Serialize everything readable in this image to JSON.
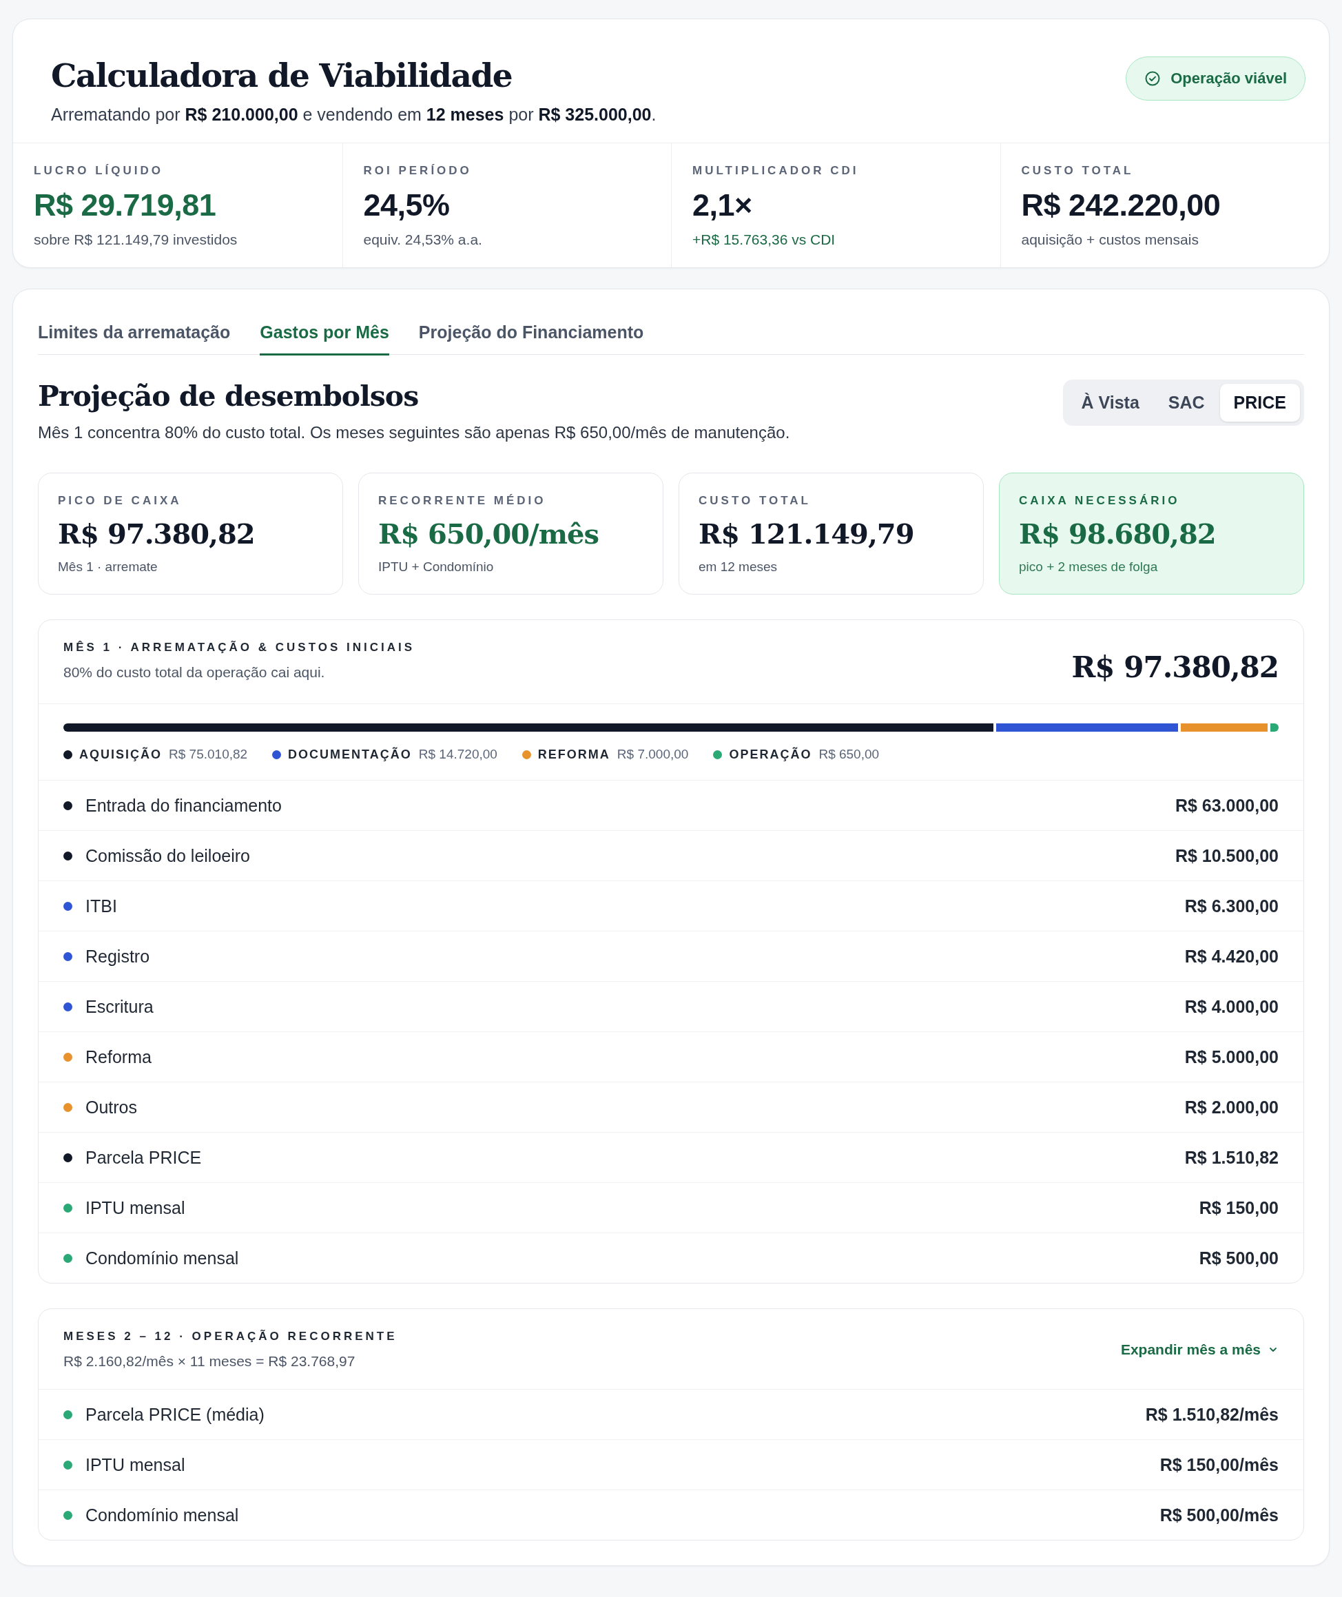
{
  "header": {
    "title": "Calculadora de Viabilidade",
    "subtitle": "Arrematando por **R$ 210.000,00** e vendendo em **12 meses** por **R$ 325.000,00**.",
    "status": {
      "label": "Operação viável",
      "ok": true
    }
  },
  "kpis": [
    {
      "label": "LUCRO LÍQUIDO",
      "value": "R$ 29.719,81",
      "note": "sobre R$ 121.149,79 investidos",
      "value_positive": true,
      "note_positive": false
    },
    {
      "label": "ROI PERÍODO",
      "value": "24,5%",
      "note": "equiv. 24,53% a.a.",
      "value_positive": false,
      "note_positive": false
    },
    {
      "label": "MULTIPLICADOR CDI",
      "value": "2,1×",
      "note": "+R$ 15.763,36 vs CDI",
      "value_positive": false,
      "note_positive": true
    },
    {
      "label": "CUSTO TOTAL",
      "value": "R$ 242.220,00",
      "note": "aquisição + custos mensais",
      "value_positive": false,
      "note_positive": false
    }
  ],
  "tabs": [
    {
      "label": "Limites da arrematação",
      "selected": false
    },
    {
      "label": "Gastos por Mês",
      "selected": true
    },
    {
      "label": "Projeção do Financiamento",
      "selected": false
    }
  ],
  "section": {
    "title": "Projeção de desembolsos",
    "description": "Mês 1 concentra 80% do custo total. Os meses seguintes são apenas R$ 650,00/mês de manutenção."
  },
  "modes": [
    {
      "label": "À Vista",
      "selected": false
    },
    {
      "label": "SAC",
      "selected": false
    },
    {
      "label": "PRICE",
      "selected": true
    }
  ],
  "summary_cards": [
    {
      "label": "PICO DE CAIXA",
      "value": "R$ 97.380,82",
      "note": "Mês 1 · arremate",
      "value_positive": false,
      "highlighted": false
    },
    {
      "label": "RECORRENTE MÉDIO",
      "value": "R$ 650,00/mês",
      "note": "IPTU + Condomínio",
      "value_positive": true,
      "highlighted": false
    },
    {
      "label": "CUSTO TOTAL",
      "value": "R$ 121.149,79",
      "note": "em 12 meses",
      "value_positive": false,
      "highlighted": false
    },
    {
      "label": "CAIXA NECESSÁRIO",
      "value": "R$ 98.680,82",
      "note": "pico + 2 meses de folga",
      "value_positive": true,
      "highlighted": true
    }
  ],
  "month_one": {
    "title": "MÊS 1 · ARREMATAÇÃO & CUSTOS INICIAIS",
    "description": "80% do custo total da operação cai aqui.",
    "total": "R$ 97.380,82",
    "categories": [
      {
        "name": "AQUISIÇÃO",
        "amount": "R$ 75.010,82",
        "color": "#111827"
      },
      {
        "name": "DOCUMENTAÇÃO",
        "amount": "R$ 14.720,00",
        "color": "#2f55d4"
      },
      {
        "name": "REFORMA",
        "amount": "R$ 7.000,00",
        "color": "#e8922e"
      },
      {
        "name": "OPERAÇÃO",
        "amount": "R$ 650,00",
        "color": "#2aa876"
      }
    ],
    "items": [
      {
        "label": "Entrada do financiamento",
        "amount": "R$ 63.000,00",
        "color": "#111827"
      },
      {
        "label": "Comissão do leiloeiro",
        "amount": "R$ 10.500,00",
        "color": "#111827"
      },
      {
        "label": "ITBI",
        "amount": "R$ 6.300,00",
        "color": "#2f55d4"
      },
      {
        "label": "Registro",
        "amount": "R$ 4.420,00",
        "color": "#2f55d4"
      },
      {
        "label": "Escritura",
        "amount": "R$ 4.000,00",
        "color": "#2f55d4"
      },
      {
        "label": "Reforma",
        "amount": "R$ 5.000,00",
        "color": "#e8922e"
      },
      {
        "label": "Outros",
        "amount": "R$ 2.000,00",
        "color": "#e8922e"
      },
      {
        "label": "Parcela PRICE",
        "amount": "R$ 1.510,82",
        "color": "#111827"
      },
      {
        "label": "IPTU mensal",
        "amount": "R$ 150,00",
        "color": "#2aa876"
      },
      {
        "label": "Condomínio mensal",
        "amount": "R$ 500,00",
        "color": "#2aa876"
      }
    ]
  },
  "recurring": {
    "title": "MESES 2 – 12 · OPERAÇÃO RECORRENTE",
    "formula": "R$ 2.160,82/mês × 11 meses = R$ 23.768,97",
    "expand": {
      "label": "Expandir mês a mês",
      "expanded": false
    },
    "items": [
      {
        "label": "Parcela PRICE (média)",
        "amount": "R$ 1.510,82/mês",
        "color": "#2aa876"
      },
      {
        "label": "IPTU mensal",
        "amount": "R$ 150,00/mês",
        "color": "#2aa876"
      },
      {
        "label": "Condomínio mensal",
        "amount": "R$ 500,00/mês",
        "color": "#2aa876"
      }
    ]
  }
}
